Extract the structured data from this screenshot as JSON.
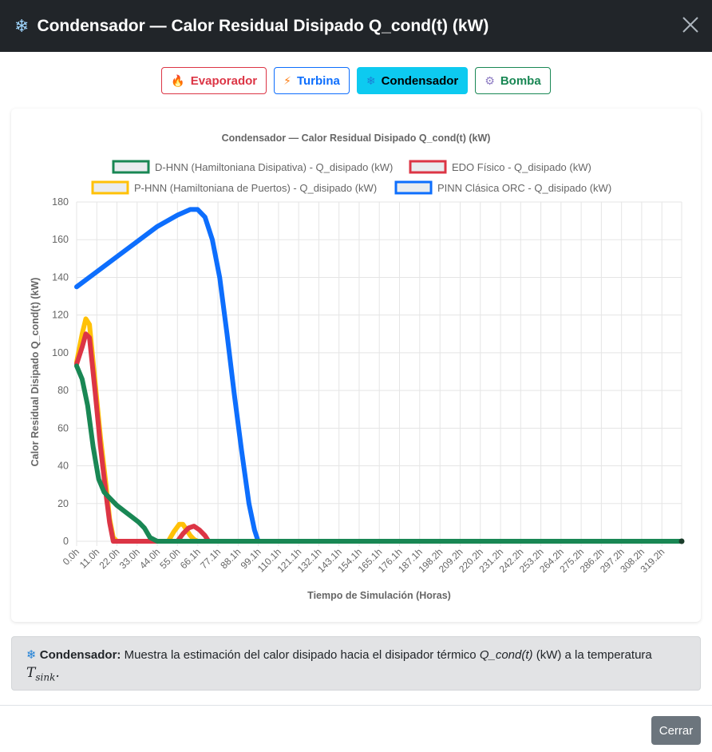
{
  "header": {
    "icon": "snowflake-icon",
    "title": "Condensador — Calor Residual Disipado Q_cond(t) (kW)"
  },
  "tabs": [
    {
      "label": "Evaporador",
      "icon": "fire-icon"
    },
    {
      "label": "Turbina",
      "icon": "lightning-icon"
    },
    {
      "label": "Condensador",
      "icon": "snowflake-icon",
      "active": true
    },
    {
      "label": "Bomba",
      "icon": "gear-icon"
    }
  ],
  "info": {
    "label": "Condensador:",
    "text_before": "Muestra la estimación del calor disipado hacia el disipador térmico",
    "var": "Q_cond(t)",
    "text_after": "(kW) a la temperatura",
    "math_main": "T",
    "math_sub": "sink",
    "math_end": "."
  },
  "footer": {
    "close_label": "Cerrar"
  },
  "chart_data": {
    "type": "line",
    "title": "Condensador — Calor Residual Disipado Q_cond(t) (kW)",
    "xlabel": "Tiempo de Simulación (Horas)",
    "ylabel": "Calor Residual Disipado Q_cond(t) (kW)",
    "ylim": [
      0,
      180
    ],
    "yticks": [
      0,
      20,
      40,
      60,
      80,
      100,
      120,
      140,
      160,
      180
    ],
    "xlim": [
      0,
      330
    ],
    "xticks": [
      "0.0h",
      "11.0h",
      "22.0h",
      "33.0h",
      "44.0h",
      "55.0h",
      "66.1h",
      "77.1h",
      "88.1h",
      "99.1h",
      "110.1h",
      "121.1h",
      "132.1h",
      "143.1h",
      "154.1h",
      "165.1h",
      "176.1h",
      "187.1h",
      "198.2h",
      "209.2h",
      "220.2h",
      "231.2h",
      "242.2h",
      "253.2h",
      "264.2h",
      "275.2h",
      "286.2h",
      "297.2h",
      "308.2h",
      "319.2h"
    ],
    "grid": true,
    "legend_position": "top",
    "series": [
      {
        "name": "D-HNN (Hamiltoniana Disipativa) - Q_disipado (kW)",
        "color": "#198754",
        "x": [
          0,
          3,
          6,
          9,
          12,
          15,
          18,
          22,
          26,
          30,
          34,
          37,
          40,
          44,
          50,
          330
        ],
        "y": [
          93,
          86,
          72,
          50,
          33,
          26,
          23,
          19,
          16,
          13,
          10,
          7,
          2,
          0,
          0,
          0
        ]
      },
      {
        "name": "EDO Físico - Q_disipado (kW)",
        "color": "#dc3545",
        "x": [
          0,
          3,
          5,
          7,
          10,
          13,
          16,
          18,
          20,
          22,
          40,
          55,
          58,
          61,
          64,
          67,
          70,
          72,
          74,
          330
        ],
        "y": [
          94,
          103,
          110,
          108,
          80,
          50,
          25,
          10,
          0,
          0,
          0,
          0,
          4,
          7,
          8,
          6,
          3,
          0,
          0,
          0
        ]
      },
      {
        "name": "P-HNN (Hamiltoniana de Puertos) - Q_disipado (kW)",
        "color": "#ffc107",
        "x": [
          0,
          3,
          5,
          7,
          10,
          13,
          16,
          18,
          20,
          22,
          50,
          53,
          56,
          58,
          60,
          62,
          64,
          66,
          330
        ],
        "y": [
          95,
          110,
          118,
          115,
          85,
          55,
          30,
          12,
          2,
          0,
          0,
          5,
          9,
          9,
          6,
          3,
          1,
          0,
          0
        ]
      },
      {
        "name": "PINN Clásica ORC - Q_disipado (kW)",
        "color": "#0d6efd",
        "x": [
          0,
          11,
          22,
          33,
          44,
          55,
          62,
          66,
          70,
          74,
          78,
          82,
          86,
          90,
          94,
          97,
          99,
          101,
          330
        ],
        "y": [
          135,
          143,
          151,
          159,
          167,
          173,
          176,
          176,
          172,
          160,
          140,
          110,
          78,
          48,
          20,
          6,
          0,
          0,
          0
        ]
      }
    ]
  }
}
